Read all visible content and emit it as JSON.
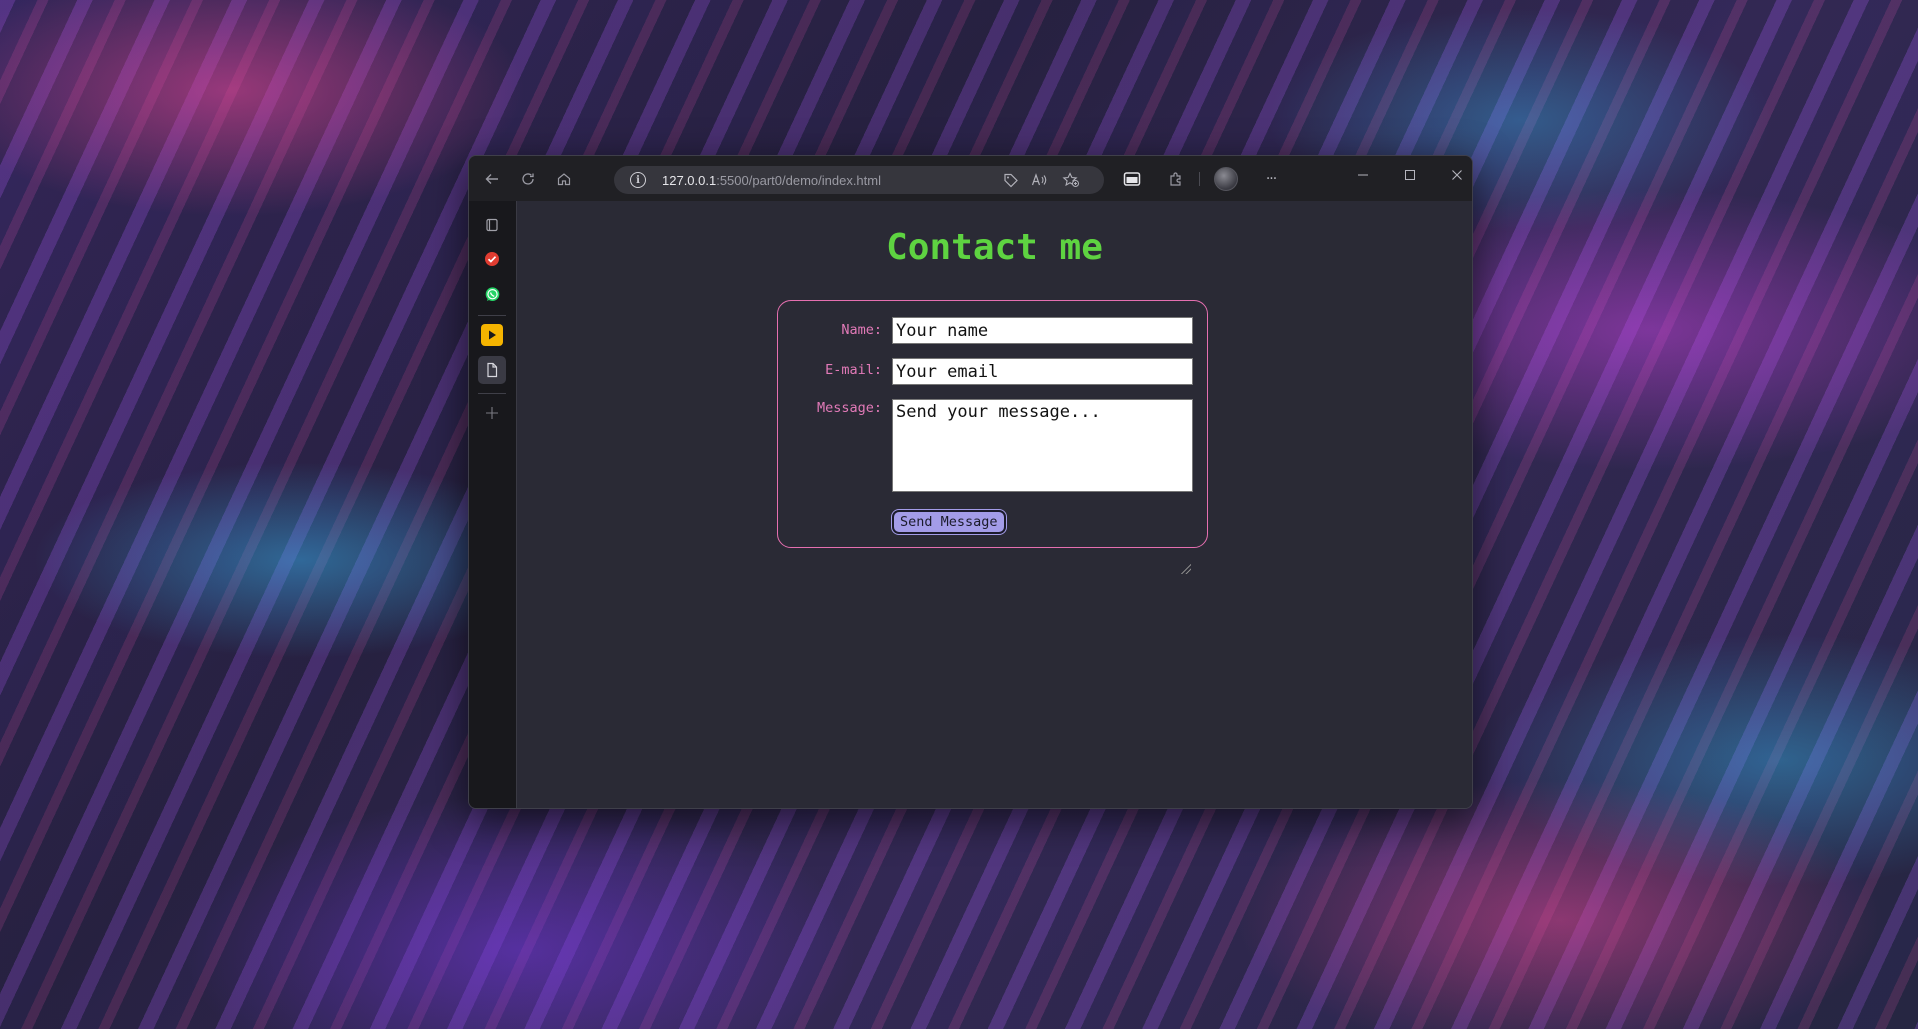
{
  "browser": {
    "url_host": "127.0.0.1",
    "url_rest": ":5500/part0/demo/index.html",
    "icons": {
      "back": "back-arrow-icon",
      "refresh": "refresh-icon",
      "home": "home-icon",
      "info": "site-info-icon",
      "coupon": "tag-icon",
      "read_aloud": "read-aloud-icon",
      "favorites": "add-favorite-icon",
      "sidebar_toggle": "split-screen-icon",
      "extensions": "extensions-icon",
      "profile": "profile-avatar",
      "more": "more-icon",
      "minimize": "minimize-icon",
      "maximize": "maximize-icon",
      "close": "close-icon"
    },
    "more_label": "···",
    "info_label": "i"
  },
  "sidebar": {
    "items": [
      {
        "name": "tab-actions",
        "icon": "tabs-icon"
      },
      {
        "name": "todo",
        "icon": "checkmark-icon",
        "color": "#e03c31"
      },
      {
        "name": "whatsapp",
        "icon": "whatsapp-icon",
        "color": "#25d366"
      },
      {
        "name": "media-player",
        "icon": "play-icon",
        "color": "#f5b400"
      },
      {
        "name": "document",
        "icon": "document-icon"
      },
      {
        "name": "add",
        "icon": "plus-icon"
      }
    ]
  },
  "page": {
    "title": "Contact me",
    "title_color": "#5ed341",
    "border_color": "#e56fb0",
    "label_color": "#e27ab8",
    "form": {
      "name_label": "Name:",
      "name_value": "Your name",
      "email_label": "E-mail:",
      "email_value": "Your email",
      "message_label": "Message:",
      "message_value": "Send your message...",
      "submit_label": "Send Message",
      "submit_color": "#a39ce8"
    }
  }
}
